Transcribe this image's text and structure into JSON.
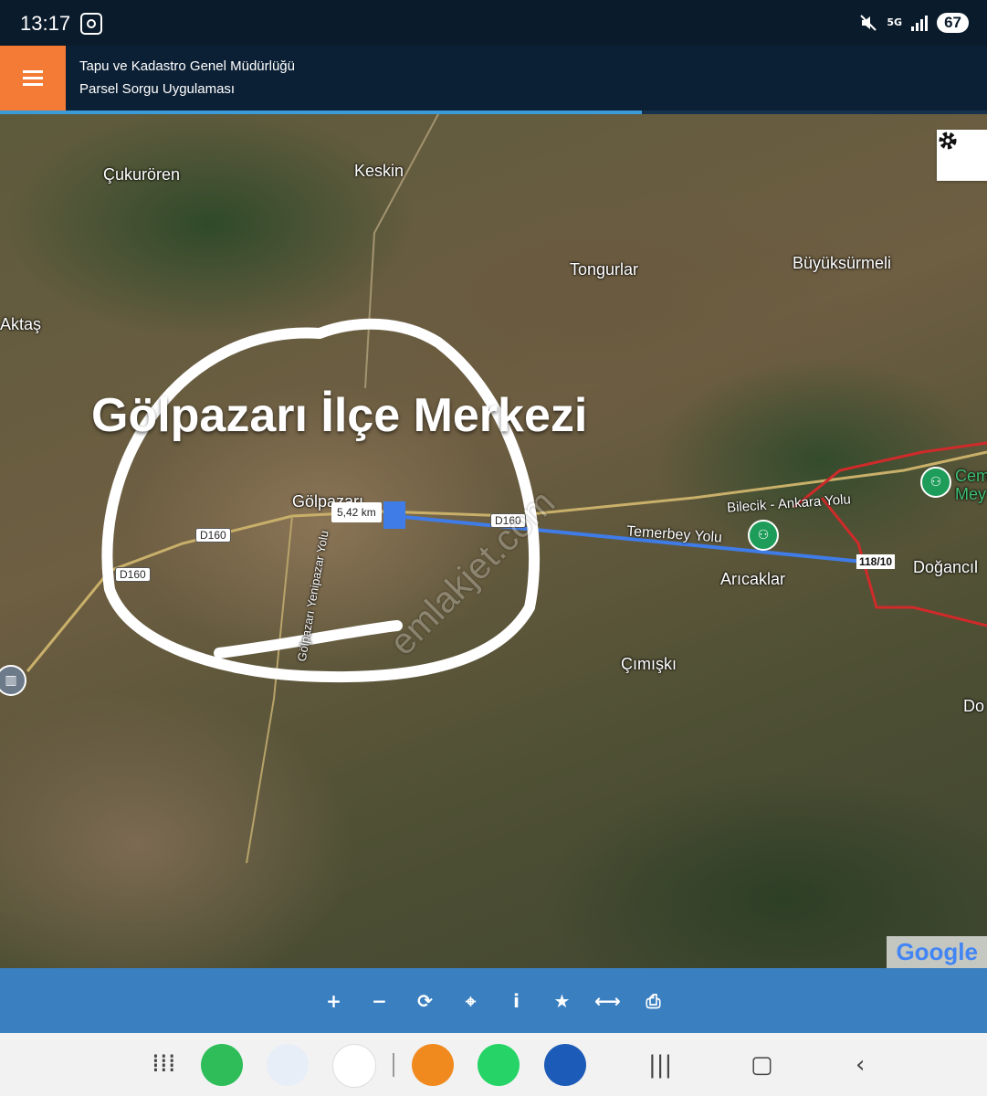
{
  "status": {
    "time": "13:17",
    "network": "5G",
    "battery": "67"
  },
  "header": {
    "line1": "Tapu ve Kadastro Genel Müdürlüğü",
    "line2": "Parsel Sorgu Uygulaması",
    "progress_percent": 65
  },
  "map": {
    "overlay_title": "Gölpazarı İlçe Merkezi",
    "places": {
      "cukuroren": "Çukurören",
      "keskin": "Keskin",
      "tongurlar": "Tongurlar",
      "buyuksurmeli": "Büyüksürmeli",
      "aktas": "Aktaş",
      "golpazari": "Gölpazarı",
      "aricaklar": "Arıcaklar",
      "cimiski": "Çımışkı",
      "dogancil": "Doğancıl",
      "cem": "Cem",
      "mey": "Mey",
      "do": "Do"
    },
    "roads": {
      "bilecik_ankara": "Bilecik - Ankara Yolu",
      "temerbey": "Temerbey Yolu",
      "yenipazar": "Gölpazarı Yenipazar Yolu",
      "d160": "D160"
    },
    "measure": "5,42 km",
    "parcel": "118/10",
    "watermark": "emlakjet.com",
    "attribution": "Google"
  },
  "toolbar": {
    "zoom_in": "+",
    "zoom_out": "−",
    "refresh": "⟳",
    "locate": "⌖",
    "info": "i",
    "favorite": "★",
    "measure": "⟷",
    "print": "⎙"
  }
}
